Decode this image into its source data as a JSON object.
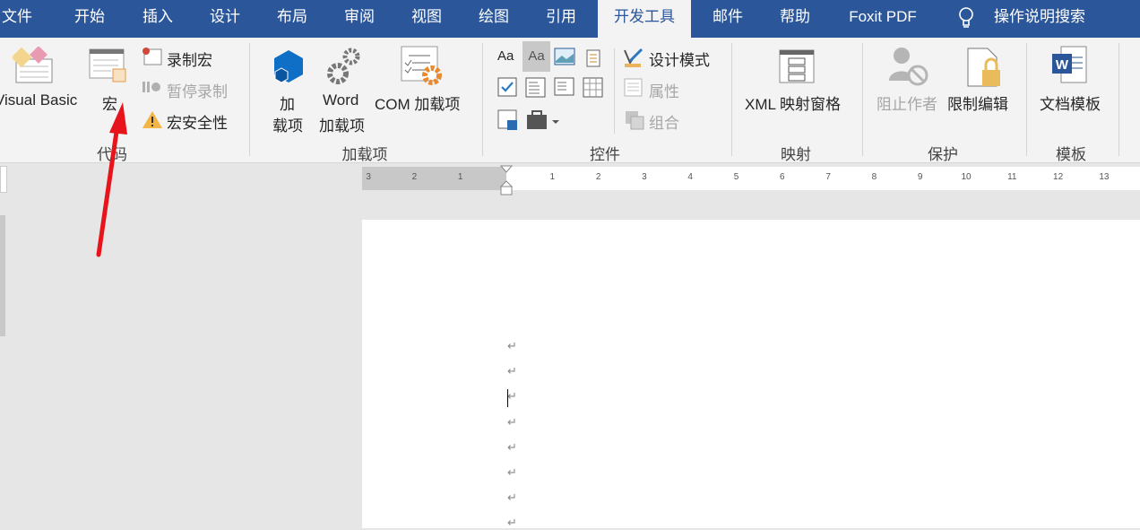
{
  "tabs": [
    "文件",
    "开始",
    "插入",
    "设计",
    "布局",
    "审阅",
    "视图",
    "绘图",
    "引用",
    "开发工具",
    "邮件",
    "帮助",
    "Foxit PDF",
    "操作说明搜索"
  ],
  "active_tab": "开发工具",
  "groups": {
    "code": {
      "label": "代码",
      "visual_basic": "Visual Basic",
      "macros": "宏",
      "record_macro": "录制宏",
      "pause_recording": "暂停录制",
      "macro_security": "宏安全性"
    },
    "addins": {
      "label": "加载项",
      "addins_1": "加",
      "addins_2": "载项",
      "word_1": "Word",
      "word_2": "加载项",
      "com": "COM 加载项"
    },
    "controls": {
      "label": "控件",
      "design_mode": "设计模式",
      "properties": "属性",
      "group": "组合",
      "aa": "Aa"
    },
    "mapping": {
      "label": "映射",
      "xml_pane": "XML 映射窗格"
    },
    "protect": {
      "label": "保护",
      "block_authors": "阻止作者",
      "restrict_editing": "限制编辑"
    },
    "templates": {
      "label": "模板",
      "document_template": "文档模板"
    }
  },
  "ruler": {
    "left": [
      "3",
      "2",
      "1"
    ],
    "right": [
      "1",
      "2",
      "3",
      "4",
      "5",
      "6",
      "7",
      "8",
      "9",
      "10",
      "11",
      "12",
      "13"
    ]
  },
  "paragraph_mark": "↵",
  "colors": {
    "brand": "#2b579a",
    "arrow": "#e8141b"
  }
}
